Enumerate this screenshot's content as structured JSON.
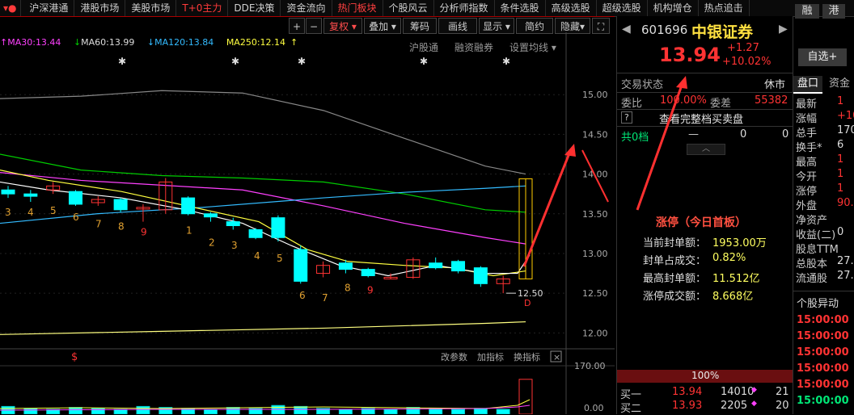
{
  "topmenu": [
    "沪深港通",
    "港股市场",
    "美股市场",
    "T+0主力",
    "DDE决策",
    "资金流向",
    "热门板块",
    "个股风云",
    "分析师指数",
    "条件选股",
    "高级选股",
    "超级选股",
    "机构增仓",
    "热点追击"
  ],
  "toolbar": {
    "plus": "+",
    "minus": "−",
    "fuquan": "复权",
    "diejia": "叠加",
    "chouma": "筹码",
    "huaxian": "画线",
    "xianshi": "显示",
    "jianyue": "简约",
    "yincang": "隐藏",
    "expand": "⛶"
  },
  "sub_toolbar": {
    "hugutong": "沪股通",
    "rongzi": "融资融券",
    "shezhi": "设置均线"
  },
  "ma": {
    "ma30": "MA30:13.44",
    "ma60": "MA60:13.99",
    "ma120": "MA120:13.84",
    "ma250": "MA250:12.14"
  },
  "colors": {
    "ma5": "#ffffff",
    "ma10": "#ffff40",
    "ma30": "#ff40ff",
    "ma60": "#00cc00",
    "ma120": "#33bbff",
    "ma250": "#ffff80",
    "up": "#ff3333",
    "down": "#00ffff",
    "accent": "#ff3333"
  },
  "chart_data": {
    "type": "candlestick",
    "y_ticks": [
      "15.00",
      "14.50",
      "14.00",
      "13.50",
      "13.00",
      "12.50",
      "12.00"
    ],
    "ylim": [
      11.8,
      15.5
    ],
    "low_marker": "12.50",
    "d_marker": "D",
    "s_marker": "$",
    "count_labels": [
      "3",
      "4",
      "5",
      "6",
      "7",
      "8",
      "9",
      "1",
      "2",
      "3",
      "4",
      "5",
      "6",
      "7",
      "8",
      "9"
    ],
    "candles": [
      {
        "o": 13.8,
        "c": 13.75,
        "h": 13.85,
        "l": 13.7
      },
      {
        "o": 13.75,
        "c": 13.72,
        "h": 13.8,
        "l": 13.65
      },
      {
        "o": 13.8,
        "c": 13.85,
        "h": 13.9,
        "l": 13.75
      },
      {
        "o": 13.78,
        "c": 13.62,
        "h": 13.8,
        "l": 13.6
      },
      {
        "o": 13.64,
        "c": 13.68,
        "h": 13.72,
        "l": 13.6
      },
      {
        "o": 13.68,
        "c": 13.55,
        "h": 13.7,
        "l": 13.52
      },
      {
        "o": 13.58,
        "c": 13.58,
        "h": 13.62,
        "l": 13.4
      },
      {
        "o": 13.55,
        "c": 13.9,
        "h": 13.95,
        "l": 13.5
      },
      {
        "o": 13.7,
        "c": 13.5,
        "h": 13.72,
        "l": 13.48
      },
      {
        "o": 13.5,
        "c": 13.46,
        "h": 13.52,
        "l": 13.4
      },
      {
        "o": 13.4,
        "c": 13.35,
        "h": 13.45,
        "l": 13.3
      },
      {
        "o": 13.3,
        "c": 13.2,
        "h": 13.32,
        "l": 13.18
      },
      {
        "o": 13.45,
        "c": 13.2,
        "h": 13.48,
        "l": 13.15
      },
      {
        "o": 13.05,
        "c": 12.65,
        "h": 13.1,
        "l": 12.62
      },
      {
        "o": 12.75,
        "c": 12.85,
        "h": 12.9,
        "l": 12.7
      },
      {
        "o": 12.88,
        "c": 12.8,
        "h": 12.92,
        "l": 12.75
      },
      {
        "o": 12.8,
        "c": 12.72,
        "h": 12.82,
        "l": 12.7
      },
      {
        "o": 12.7,
        "c": 12.7,
        "h": 12.75,
        "l": 12.68
      },
      {
        "o": 12.7,
        "c": 12.92,
        "h": 12.95,
        "l": 12.68
      },
      {
        "o": 12.88,
        "c": 12.82,
        "h": 12.95,
        "l": 12.8
      },
      {
        "o": 12.9,
        "c": 12.78,
        "h": 12.92,
        "l": 12.75
      },
      {
        "o": 12.82,
        "c": 12.62,
        "h": 12.84,
        "l": 12.58
      },
      {
        "o": 12.62,
        "c": 12.68,
        "h": 12.72,
        "l": 12.5
      },
      {
        "o": 12.68,
        "c": 13.94,
        "h": 13.94,
        "l": 12.68
      }
    ],
    "volume_ylim": [
      0,
      170
    ],
    "volume_ticks": [
      "170.00",
      "0.00"
    ],
    "volume_toolbar": [
      "改参数",
      "加指标",
      "换指标"
    ]
  },
  "stock": {
    "code": "601696",
    "name": "中银证券",
    "price": "13.94",
    "change": "+1.27",
    "pct": "+10.02%",
    "rong": "融",
    "gang": "港",
    "zixuan": "自选+"
  },
  "panel": {
    "status_label": "交易状态",
    "status_value": "休市",
    "weibi_label": "委比",
    "weibi_value": "100.00%",
    "weicha_label": "委差",
    "weicha_value": "55382",
    "full_book": "查看完整档买卖盘",
    "help": "?",
    "gong_label": "共0档",
    "gong_dash": "—",
    "gong_v1": "0",
    "gong_v2": "0",
    "zt_title": "涨停（今日首板）",
    "zt_rows": [
      {
        "k": "当前封单额：",
        "v": "1953.00万"
      },
      {
        "k": "封单占成交：",
        "v": "0.82%"
      },
      {
        "k": "最高封单额：",
        "v": "11.512亿"
      },
      {
        "k": "涨停成交额：",
        "v": "8.668亿"
      }
    ],
    "pct_bar": "100%",
    "buy_rows": [
      {
        "k": "买一",
        "p": "13.94",
        "v": "14010",
        "n": "21"
      },
      {
        "k": "买二",
        "p": "13.93",
        "v": "2205",
        "n": "20"
      }
    ]
  },
  "far": {
    "tabs": [
      "盘口",
      "资金"
    ],
    "rows": [
      {
        "k": "最新",
        "v": "1"
      },
      {
        "k": "涨幅",
        "v": "+10"
      },
      {
        "k": "总手",
        "v": "170."
      },
      {
        "k": "换手*",
        "v": "6"
      },
      {
        "k": "最高",
        "v": "1"
      },
      {
        "k": "今开",
        "v": "1"
      },
      {
        "k": "涨停",
        "v": "1"
      },
      {
        "k": "外盘",
        "v": "90."
      },
      {
        "k": "净资产",
        "v": ""
      },
      {
        "k": "收益(二)",
        "v": "0"
      },
      {
        "k": "股息TTM",
        "v": ""
      },
      {
        "k": "总股本",
        "v": "27."
      },
      {
        "k": "流通股",
        "v": "27."
      }
    ],
    "yidong_title": "个股异动",
    "yidong": [
      "15:00:00",
      "15:00:00",
      "15:00:00",
      "15:00:00",
      "15:00:00",
      "15:00:00"
    ]
  }
}
